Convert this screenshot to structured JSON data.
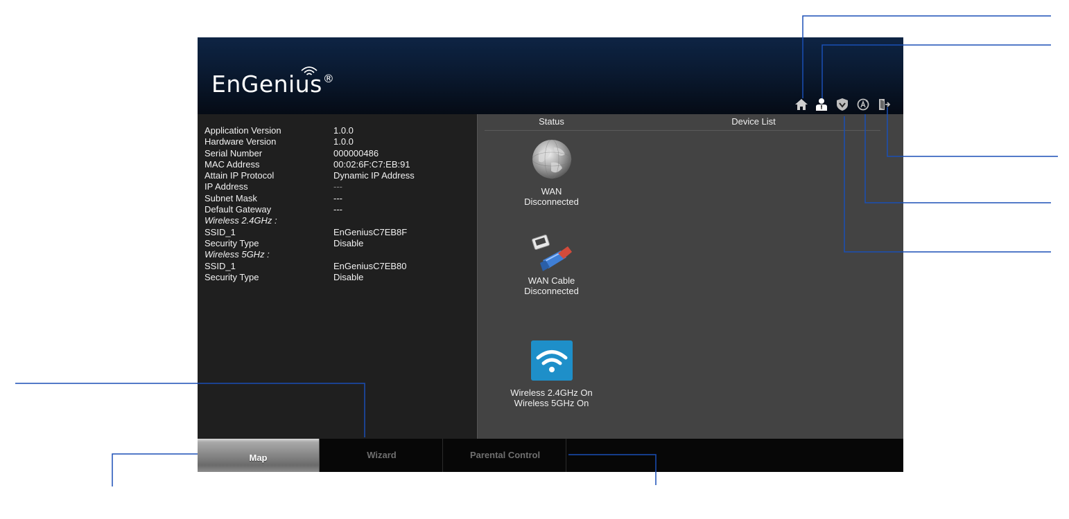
{
  "brand": {
    "name": "EnGenius",
    "trademark": "®"
  },
  "toolbar": {
    "items": [
      {
        "name": "home",
        "icon": "home-icon"
      },
      {
        "name": "account",
        "icon": "user-icon"
      },
      {
        "name": "tools",
        "icon": "shield-icon"
      },
      {
        "name": "firmware",
        "icon": "refresh-icon"
      },
      {
        "name": "logout",
        "icon": "logout-icon"
      }
    ]
  },
  "info": {
    "rows": [
      {
        "key": "Application Version",
        "value": "1.0.0"
      },
      {
        "key": "Hardware Version",
        "value": "1.0.0"
      },
      {
        "key": "Serial Number",
        "value": "000000486"
      },
      {
        "key": "MAC Address",
        "value": "00:02:6F:C7:EB:91"
      },
      {
        "key": "Attain IP Protocol",
        "value": "Dynamic IP Address"
      },
      {
        "key": "IP Address",
        "value": "---"
      },
      {
        "key": "Subnet Mask",
        "value": "---"
      },
      {
        "key": "Default Gateway",
        "value": "---"
      },
      {
        "key": "Wireless 2.4GHz :",
        "value": ""
      },
      {
        "key": "SSID_1",
        "value": "EnGeniusC7EB8F"
      },
      {
        "key": "Security Type",
        "value": "Disable"
      },
      {
        "key": "Wireless 5GHz :",
        "value": ""
      },
      {
        "key": "SSID_1",
        "value": "EnGeniusC7EB80"
      },
      {
        "key": "Security Type",
        "value": "Disable"
      }
    ]
  },
  "status": {
    "header": "Status",
    "wan": {
      "line1": "WAN",
      "line2": "Disconnected"
    },
    "wan_cable": {
      "line1": "WAN Cable",
      "line2": "Disconnected"
    },
    "wireless": {
      "line1": "Wireless 2.4GHz On",
      "line2": "Wireless 5GHz On"
    }
  },
  "device_list": {
    "header": "Device List"
  },
  "tabs": [
    {
      "label": "Map",
      "active": true
    },
    {
      "label": "Wizard",
      "active": false
    },
    {
      "label": "Parental Control",
      "active": false
    }
  ],
  "colors": {
    "header_top": "#0e2444",
    "panel_dark": "#1f1f1f",
    "panel_gray": "#434343",
    "callout_line": "#1a4fb5",
    "wifi_tile": "#1e8fc9"
  }
}
